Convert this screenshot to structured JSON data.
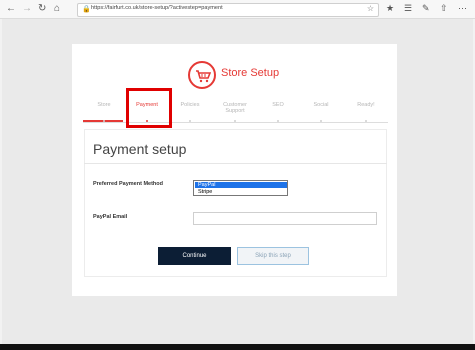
{
  "browser": {
    "url": "https://fairfurt.co.uk/store-setup/?activestep=payment",
    "back_icon": "back-arrow-icon",
    "forward_icon": "forward-arrow-icon",
    "refresh_icon": "refresh-icon",
    "home_icon": "home-icon"
  },
  "brand": {
    "name": "Store Setup",
    "accent": "#e53935"
  },
  "steps": [
    {
      "label": "Store"
    },
    {
      "label": "Payment",
      "active": true
    },
    {
      "label": "Policies"
    },
    {
      "label": "Customer\nSupport"
    },
    {
      "label": "SEO"
    },
    {
      "label": "Social"
    },
    {
      "label": "Ready!"
    }
  ],
  "payment": {
    "title": "Payment setup",
    "preferred_method_label": "Preferred Payment Method",
    "options": [
      "PayPal",
      "Stripe"
    ],
    "selected_option": "PayPal",
    "paypal_email_label": "PayPal Email",
    "paypal_email_value": "",
    "continue_label": "Continue",
    "skip_label": "Skip this step"
  }
}
